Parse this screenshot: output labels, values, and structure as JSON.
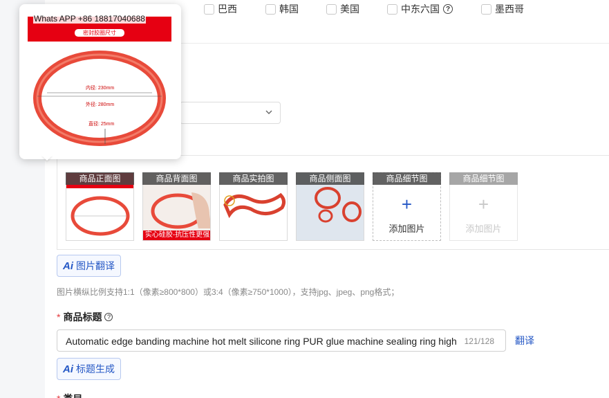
{
  "countries": [
    {
      "label": "巴西",
      "checked": false
    },
    {
      "label": "韩国",
      "checked": false
    },
    {
      "label": "美国",
      "checked": false
    },
    {
      "label": "中东六国",
      "checked": false,
      "help": true
    },
    {
      "label": "墨西哥",
      "checked": false
    }
  ],
  "product_images": {
    "slots": [
      {
        "label": "商品正面图",
        "filled": true,
        "image_caption": ""
      },
      {
        "label": "商品背面图",
        "filled": true,
        "image_caption": "实心硅胶-抗压性更强"
      },
      {
        "label": "商品实拍图",
        "filled": true,
        "image_caption": ""
      },
      {
        "label": "商品侧面图",
        "filled": true,
        "image_caption": ""
      },
      {
        "label": "商品细节图",
        "filled": false,
        "add_label": "添加图片",
        "enabled": true
      },
      {
        "label": "商品细节图",
        "filled": false,
        "add_label": "添加图片",
        "enabled": false
      }
    ],
    "ai_translate_button": "图片翻译",
    "hint": "图片横纵比例支持1:1（像素≥800*800）或3:4（像素≥750*1000），支持jpg、jpeg、png格式；"
  },
  "title_field": {
    "label": "商品标题",
    "value": "Automatic edge banding machine hot melt silicone ring PUR glue machine sealing ring high temperature resistant",
    "count": "121/128",
    "translate_link": "翻译",
    "ai_generate_button": "标题生成"
  },
  "next_field_label": "类目",
  "ai_mark": "Ai",
  "preview_popup": {
    "watermark": "Whats APP +86 18817040688",
    "banner_subtitle": "密封胶圈尺寸",
    "inner_diameter": "内径: 230mm",
    "outer_diameter": "外径: 280mm",
    "thickness": "直径: 25mm"
  },
  "colors": {
    "accent": "#2457c5",
    "required": "#e4393c",
    "ring": "#e84a3a",
    "banner": "#e60012"
  }
}
